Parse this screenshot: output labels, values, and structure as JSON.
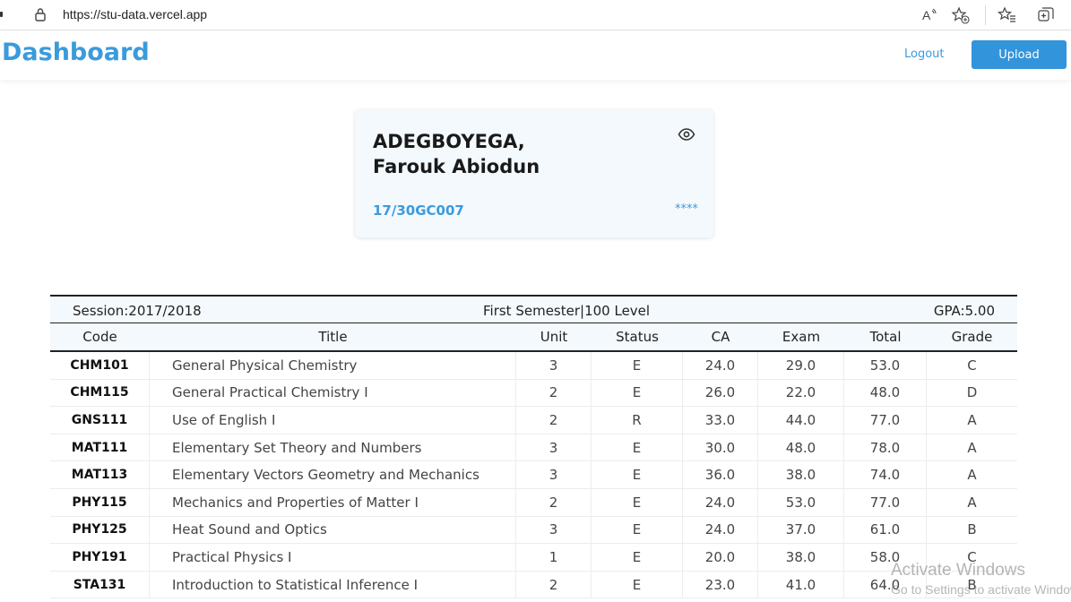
{
  "browser": {
    "url": "https://stu-data.vercel.app"
  },
  "header": {
    "title": "Dashboard",
    "logout_label": "Logout",
    "upload_label": "Upload",
    "accent_color": "#3a9bdc"
  },
  "student": {
    "name_line1": "ADEGBOYEGA,",
    "name_line2": "Farouk Abiodun",
    "matric_no": "17/30GC007",
    "masked_value": "****"
  },
  "results": {
    "session": "Session:2017/2018",
    "semester_level": "First Semester|100 Level",
    "gpa": "GPA:5.00",
    "columns": [
      "Code",
      "Title",
      "Unit",
      "Status",
      "CA",
      "Exam",
      "Total",
      "Grade"
    ],
    "rows": [
      [
        "CHM101",
        "General Physical Chemistry",
        "3",
        "E",
        "24.0",
        "29.0",
        "53.0",
        "C"
      ],
      [
        "CHM115",
        "General Practical Chemistry I",
        "2",
        "E",
        "26.0",
        "22.0",
        "48.0",
        "D"
      ],
      [
        "GNS111",
        "Use of English I",
        "2",
        "R",
        "33.0",
        "44.0",
        "77.0",
        "A"
      ],
      [
        "MAT111",
        "Elementary Set Theory and Numbers",
        "3",
        "E",
        "30.0",
        "48.0",
        "78.0",
        "A"
      ],
      [
        "MAT113",
        "Elementary Vectors Geometry and Mechanics",
        "3",
        "E",
        "36.0",
        "38.0",
        "74.0",
        "A"
      ],
      [
        "PHY115",
        "Mechanics and Properties of Matter I",
        "2",
        "E",
        "24.0",
        "53.0",
        "77.0",
        "A"
      ],
      [
        "PHY125",
        "Heat Sound and Optics",
        "3",
        "E",
        "24.0",
        "37.0",
        "61.0",
        "B"
      ],
      [
        "PHY191",
        "Practical Physics I",
        "1",
        "E",
        "20.0",
        "38.0",
        "58.0",
        "C"
      ],
      [
        "STA131",
        "Introduction to Statistical Inference I",
        "2",
        "E",
        "23.0",
        "41.0",
        "64.0",
        "B"
      ]
    ]
  },
  "watermark": {
    "line1": "Activate Windows",
    "line2": "Go to Settings to activate Windows."
  }
}
